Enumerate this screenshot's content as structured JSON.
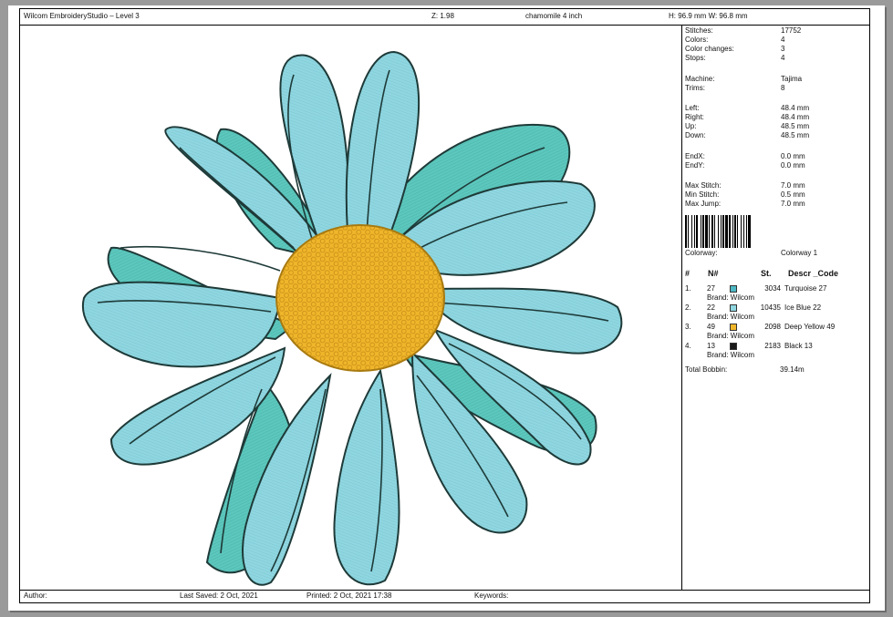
{
  "header": {
    "app_title": "Wilcom EmbroideryStudio – Level 3",
    "zoom": "Z: 1.98",
    "design_name": "chamomile 4 inch",
    "dimensions": "H: 96.9 mm   W: 96.8 mm"
  },
  "stats": {
    "stitches_label": "Stitches:",
    "stitches": "17752",
    "colors_label": "Colors:",
    "colors": "4",
    "color_changes_label": "Color changes:",
    "color_changes": "3",
    "stops_label": "Stops:",
    "stops": "4",
    "machine_label": "Machine:",
    "machine": "Tajima",
    "trims_label": "Trims:",
    "trims": "8",
    "left_label": "Left:",
    "left": "48.4 mm",
    "right_label": "Right:",
    "right": "48.4 mm",
    "up_label": "Up:",
    "up": "48.5 mm",
    "down_label": "Down:",
    "down": "48.5 mm",
    "endx_label": "EndX:",
    "endx": "0.0 mm",
    "endy_label": "EndY:",
    "endy": "0.0 mm",
    "max_stitch_label": "Max Stitch:",
    "max_stitch": "7.0 mm",
    "min_stitch_label": "Min Stitch:",
    "min_stitch": "0.5 mm",
    "max_jump_label": "Max Jump:",
    "max_jump": "7.0 mm"
  },
  "colorway": {
    "label": "Colorway:",
    "value": "Colorway 1"
  },
  "thread_table": {
    "col_num": "#",
    "col_n": "N#",
    "col_st": "St.",
    "col_descr": "Descr _Code",
    "rows": [
      {
        "idx": "1.",
        "n": "27",
        "st": "3034",
        "descr": "Turquoise 27",
        "brand": "Brand: Wilcom",
        "color": "#4db8c4"
      },
      {
        "idx": "2.",
        "n": "22",
        "st": "10435",
        "descr": "Ice Blue 22",
        "brand": "Brand: Wilcom",
        "color": "#8fd6e0"
      },
      {
        "idx": "3.",
        "n": "49",
        "st": "2098",
        "descr": "Deep Yellow 49",
        "brand": "Brand: Wilcom",
        "color": "#f0b62b"
      },
      {
        "idx": "4.",
        "n": "13",
        "st": "2183",
        "descr": "Black 13",
        "brand": "Brand: Wilcom",
        "color": "#1a1a1a"
      }
    ],
    "total_label": "Total Bobbin:",
    "total_value": "39.14m"
  },
  "footer": {
    "author": "Author:",
    "last_saved": "Last Saved:  2 Oct, 2021",
    "printed": "Printed:  2 Oct, 2021 17:38",
    "keywords": "Keywords:"
  },
  "colors": {
    "petal_light": "#8fd6e0",
    "petal_dark": "#5cc7bd",
    "center": "#f0b62b",
    "outline": "#1e3a38"
  }
}
